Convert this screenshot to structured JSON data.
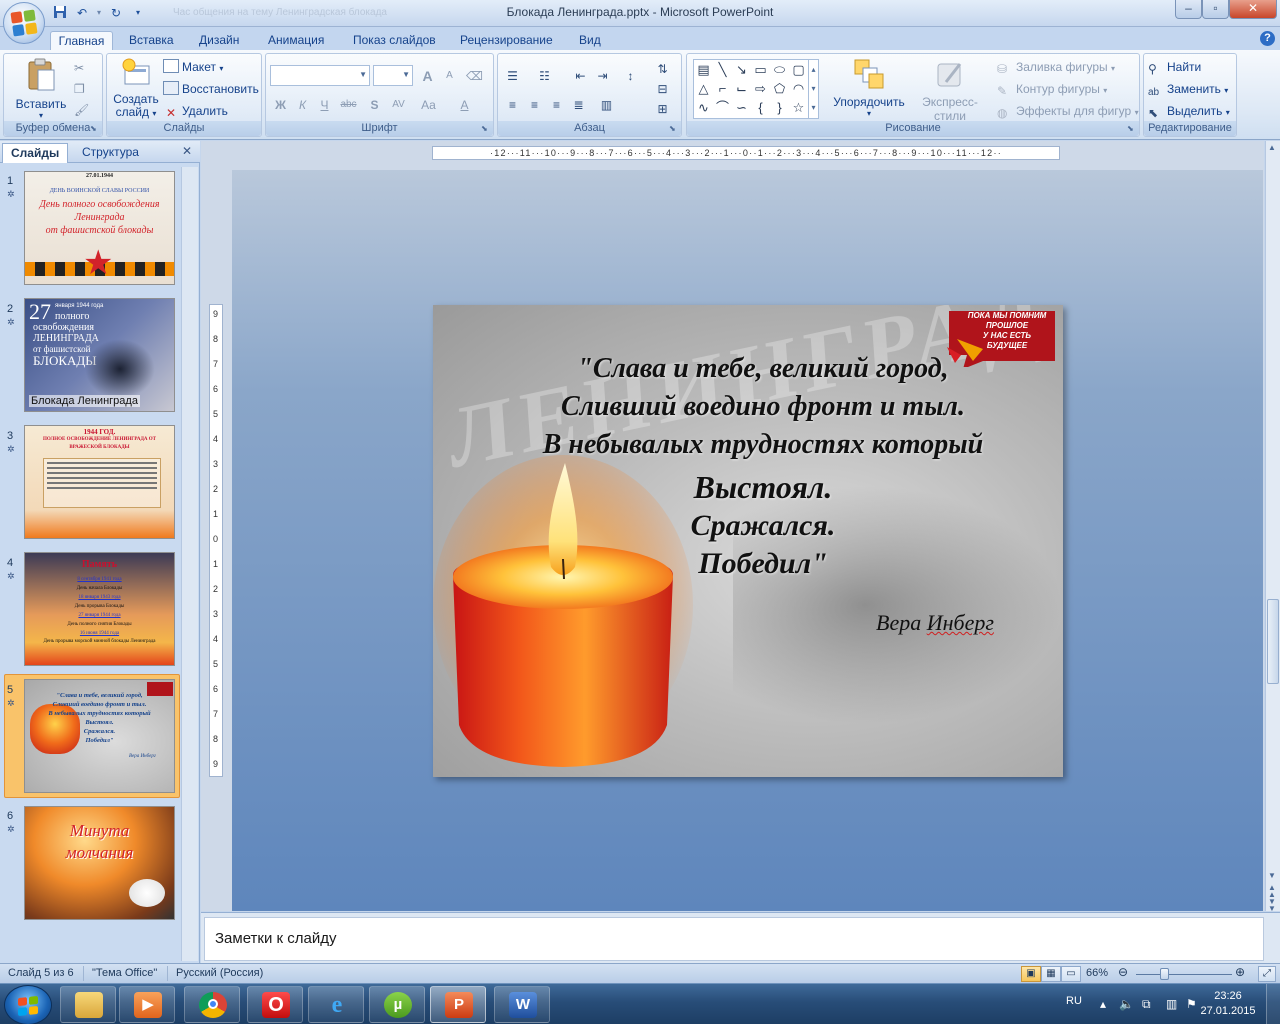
{
  "window": {
    "title": "Блокада Ленинграда.pptx - Microsoft PowerPoint",
    "faded_title": "Час общения на тему Ленинградская блокада"
  },
  "tabs": [
    "Главная",
    "Вставка",
    "Дизайн",
    "Анимация",
    "Показ слайдов",
    "Рецензирование",
    "Вид"
  ],
  "ribbon": {
    "clipboard": {
      "label": "Буфер обмена",
      "paste": "Вставить"
    },
    "slides": {
      "label": "Слайды",
      "new_slide": "Создать слайд",
      "layout": "Макет",
      "reset": "Восстановить",
      "delete": "Удалить"
    },
    "font": {
      "label": "Шрифт",
      "bold": "Ж",
      "italic": "К",
      "underline": "Ч",
      "strike": "abc",
      "shadow": "S",
      "spacing": "AV",
      "case": "Aa",
      "grow": "A",
      "shrink": "A"
    },
    "paragraph": {
      "label": "Абзац"
    },
    "drawing": {
      "label": "Рисование",
      "arrange": "Упорядочить",
      "quick_styles": "Экспресс-стили",
      "fill": "Заливка фигуры",
      "outline": "Контур фигуры",
      "effects": "Эффекты для фигур"
    },
    "editing": {
      "label": "Редактирование",
      "find": "Найти",
      "replace": "Заменить",
      "select": "Выделить"
    }
  },
  "pane": {
    "tab_slides": "Слайды",
    "tab_outline": "Структура",
    "slides": [
      {
        "num": "1",
        "lines": [
          "27.01.1944",
          "ДЕНЬ ВОИНСКОЙ СЛАВЫ РОССИИ",
          "День полного освобождения",
          "Ленинграда",
          "от фашистской блокады"
        ]
      },
      {
        "num": "2",
        "lines": [
          "27",
          "января 1944 года",
          "полного",
          "освобождения",
          "ЛЕНИНГРАДА",
          "от фашистской",
          "БЛОКАДЫ",
          "Блокада Ленинграда"
        ]
      },
      {
        "num": "3",
        "lines": [
          "1944 ГОД.",
          "ПОЛНОЕ ОСВОБОЖДЕНИЕ ЛЕНИНГРАДА ОТ",
          "ВРАЖЕСКОЙ БЛОКАДЫ"
        ]
      },
      {
        "num": "4",
        "lines": [
          "Память",
          "8 сентября 1941 года",
          "День начала Блокады",
          "18 января 1943 года",
          "День прорыва Блокады",
          "27 января 1944 года",
          "День полного снятия Блокады",
          "16 июня 1944 года",
          "День прорыва морской минной блокады Ленинграда"
        ]
      },
      {
        "num": "5",
        "lines": [
          "\"Слава и тебе, великий город,",
          "Сливший воедино фронт и тыл.",
          "В небывалых трудностях который",
          "Выстоял.",
          "Сражался.",
          "Победил\"",
          "Вера Инберг"
        ]
      },
      {
        "num": "6",
        "lines": [
          "Минута",
          "молчания"
        ]
      }
    ]
  },
  "slide": {
    "watermark": "ЛЕНИНГРАД",
    "poem": [
      "\"Слава и тебе, великий город,",
      "Сливший воедино фронт и тыл.",
      "В небывалых трудностях который",
      "Выстоял.",
      "Сражался.",
      "Победил\""
    ],
    "author_first": "Вера",
    "author_last": "Инберг",
    "badge_lines": [
      "ПОКА МЫ ПОМНИМ",
      "ПРОШЛОЕ",
      "У НАС ЕСТЬ",
      "БУДУЩЕЕ"
    ]
  },
  "notes": {
    "placeholder": "Заметки к слайду"
  },
  "status": {
    "slide_pos": "Слайд 5 из 6",
    "theme": "\"Тема Office\"",
    "language": "Русский (Россия)",
    "zoom": "66%"
  },
  "taskbar": {
    "lang": "RU",
    "time": "23:26",
    "date": "27.01.2015"
  },
  "colors": {
    "ribbon_text": "#15428b",
    "title_bar": "#c6d7ee",
    "accent_selected": "#f9c36a",
    "close_button": "#c8462a"
  }
}
